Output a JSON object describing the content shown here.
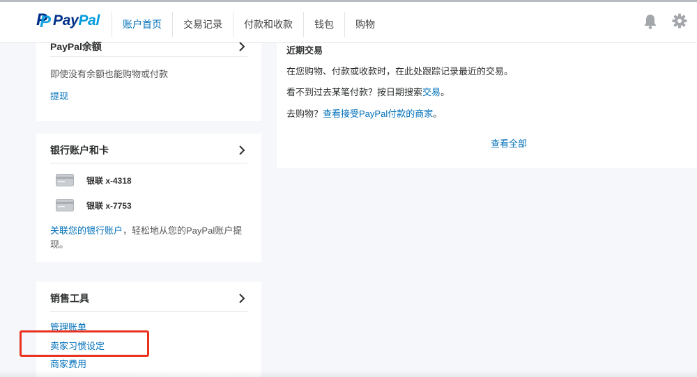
{
  "brand": {
    "pay": "Pay",
    "pal": "Pal",
    "mark": "P"
  },
  "nav": [
    {
      "label": "账户首页"
    },
    {
      "label": "交易记录"
    },
    {
      "label": "付款和收款"
    },
    {
      "label": "钱包"
    },
    {
      "label": "购物"
    }
  ],
  "icons": {
    "notifications": "bell-icon",
    "settings": "gear-icon"
  },
  "balance": {
    "title": "PayPal余额",
    "description": "即使没有余额也能购物或付款",
    "withdraw_link": "提现"
  },
  "bank": {
    "title": "银行账户和卡",
    "cards": [
      {
        "label": "银联 x-4318"
      },
      {
        "label": "银联 x-7753"
      }
    ],
    "link_text": "关联您的银行账户",
    "link_rest_line1": "，轻松地从您的PayPal账户提",
    "link_rest_line2": "现。"
  },
  "selling_tools": {
    "title": "销售工具",
    "items": [
      {
        "label": "管理账单"
      },
      {
        "label": "卖家习惯设定"
      },
      {
        "label": "商家费用"
      }
    ]
  },
  "recent": {
    "title": "近期交易",
    "line1": "在您购物、付款或收款时，在此处跟踪记录最近的交易。",
    "line2_prefix": "看不到过去某笔付款？按日期搜索",
    "line2_link": "交易",
    "line2_suffix": "。",
    "line3_prefix": "去购物？",
    "line3_link": "查看接受PayPal付款的商家",
    "line3_suffix": "。",
    "view_all": "查看全部"
  },
  "colors": {
    "link": "#0070ba",
    "highlight": "#e8311e",
    "brand_dark": "#003087",
    "brand_light": "#009cde"
  }
}
